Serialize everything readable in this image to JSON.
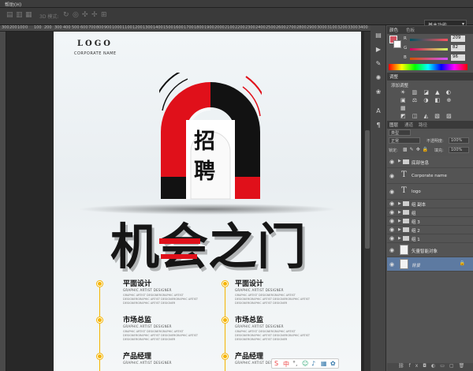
{
  "menubar": {
    "items": [
      "帮助(H)"
    ]
  },
  "options_bar": {
    "mode3d_label": "3D 模式:",
    "workspace": "基本功能"
  },
  "ruler": {
    "ticks": [
      "300",
      "200",
      "100",
      "0",
      "100",
      "200",
      "300",
      "400",
      "500",
      "600",
      "700",
      "800",
      "900",
      "1000",
      "1100",
      "1200",
      "1300",
      "1400",
      "1500",
      "1600",
      "1700",
      "1800",
      "1900",
      "2000",
      "2100",
      "2200",
      "2300",
      "2400",
      "2500",
      "2600",
      "2700",
      "2800",
      "2900",
      "3000",
      "3100",
      "3200",
      "3300",
      "3400",
      "3500",
      "3600",
      "3700",
      "3800",
      "3900",
      "4000",
      "4100",
      "4200"
    ]
  },
  "poster": {
    "logo": "LOGO",
    "corp": "CORPORATE NAME",
    "magnet_text_1": "招",
    "magnet_text_2": "聘",
    "headline": "机会之门",
    "items_left": [
      {
        "title": "平面设计",
        "sub": "GRAPHIC ARTIST DESIGNER",
        "desc": "GRAPHIC ARTIST DESIGNERGRAPHIC ARTIST DESIGNERGRAPHIC ARTIST DESIGNERGRAPHIC ARTIST DESIGNERGRAPHIC ARTIST DESIGNER"
      },
      {
        "title": "市场总监",
        "sub": "GRAPHIC ARTIST DESIGNER",
        "desc": "GRAPHIC ARTIST DESIGNERGRAPHIC ARTIST DESIGNERGRAPHIC ARTIST DESIGNERGRAPHIC ARTIST DESIGNERGRAPHIC ARTIST DESIGNER"
      },
      {
        "title": "产品经理",
        "sub": "GRAPHIC ARTIST DESIGNER",
        "desc": ""
      }
    ],
    "items_right": [
      {
        "title": "平面设计",
        "sub": "GRAPHIC ARTIST DESIGNER",
        "desc": "GRAPHIC ARTIST DESIGNERGRAPHIC ARTIST DESIGNERGRAPHIC ARTIST DESIGNERGRAPHIC ARTIST DESIGNERGRAPHIC ARTIST DESIGNER"
      },
      {
        "title": "市场总监",
        "sub": "GRAPHIC ARTIST DESIGNER",
        "desc": "GRAPHIC ARTIST DESIGNERGRAPHIC ARTIST DESIGNERGRAPHIC ARTIST DESIGNERGRAPHIC ARTIST DESIGNERGRAPHIC ARTIST DESIGNER"
      },
      {
        "title": "产品经理",
        "sub": "GRAPHIC ARTIST DESIGNER",
        "desc": ""
      }
    ]
  },
  "color_panel": {
    "tab_color": "颜色",
    "tab_swatches": "色板",
    "r_label": "R",
    "r_value": "209",
    "g_label": "G",
    "g_value": "82",
    "b_label": "B",
    "b_value": "96",
    "fg_color": "#d15260"
  },
  "adjust_panel": {
    "tab": "调整",
    "title": "添加调整"
  },
  "layers_panel": {
    "tabs": [
      "图层",
      "通道",
      "路径"
    ],
    "kind": "类型",
    "blend_mode": "正常",
    "opacity_label": "不透明度:",
    "opacity_value": "100%",
    "lock_label": "锁定:",
    "fill_label": "填充:",
    "fill_value": "100%",
    "layers": [
      {
        "type": "folder",
        "name": "底部信息"
      },
      {
        "type": "text",
        "name": "Corporate name"
      },
      {
        "type": "text",
        "name": "logo"
      },
      {
        "type": "folder",
        "name": "组 副本"
      },
      {
        "type": "folder",
        "name": "组"
      },
      {
        "type": "folder",
        "name": "组 3"
      },
      {
        "type": "folder",
        "name": "组 2"
      },
      {
        "type": "folder",
        "name": "组 1"
      },
      {
        "type": "smart",
        "name": "矢量智能对象"
      },
      {
        "type": "bg",
        "name": "背景"
      }
    ]
  }
}
